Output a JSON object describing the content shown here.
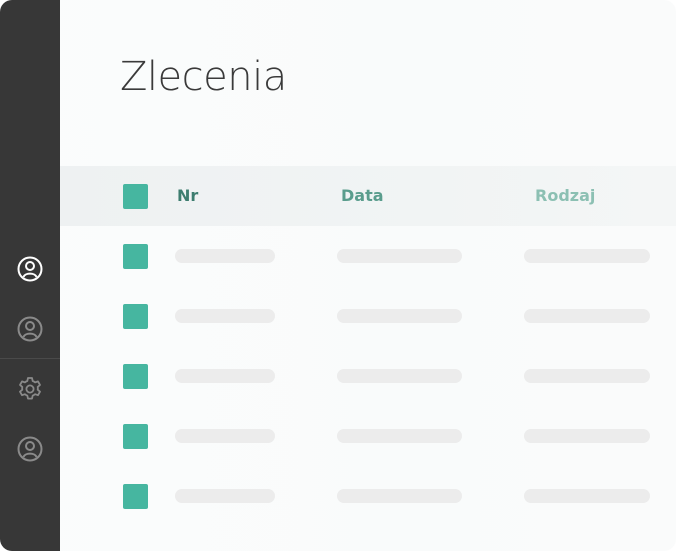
{
  "page": {
    "title": "Zlecenia"
  },
  "table": {
    "columns": [
      {
        "label": "Nr",
        "color": "#3d7d6f"
      },
      {
        "label": "Data",
        "color": "#5a9d8d"
      },
      {
        "label": "Rodzaj",
        "color": "#8cc0b3"
      }
    ],
    "row_count": 5
  },
  "sidebar": {
    "items": [
      {
        "icon": "user-icon",
        "active": true
      },
      {
        "icon": "user-icon",
        "active": false
      },
      {
        "icon": "gear-icon",
        "active": false
      },
      {
        "icon": "user-icon",
        "active": false
      }
    ]
  },
  "colors": {
    "sidebar_bg": "#373737",
    "accent": "#46b6a0",
    "placeholder": "#ececec"
  }
}
